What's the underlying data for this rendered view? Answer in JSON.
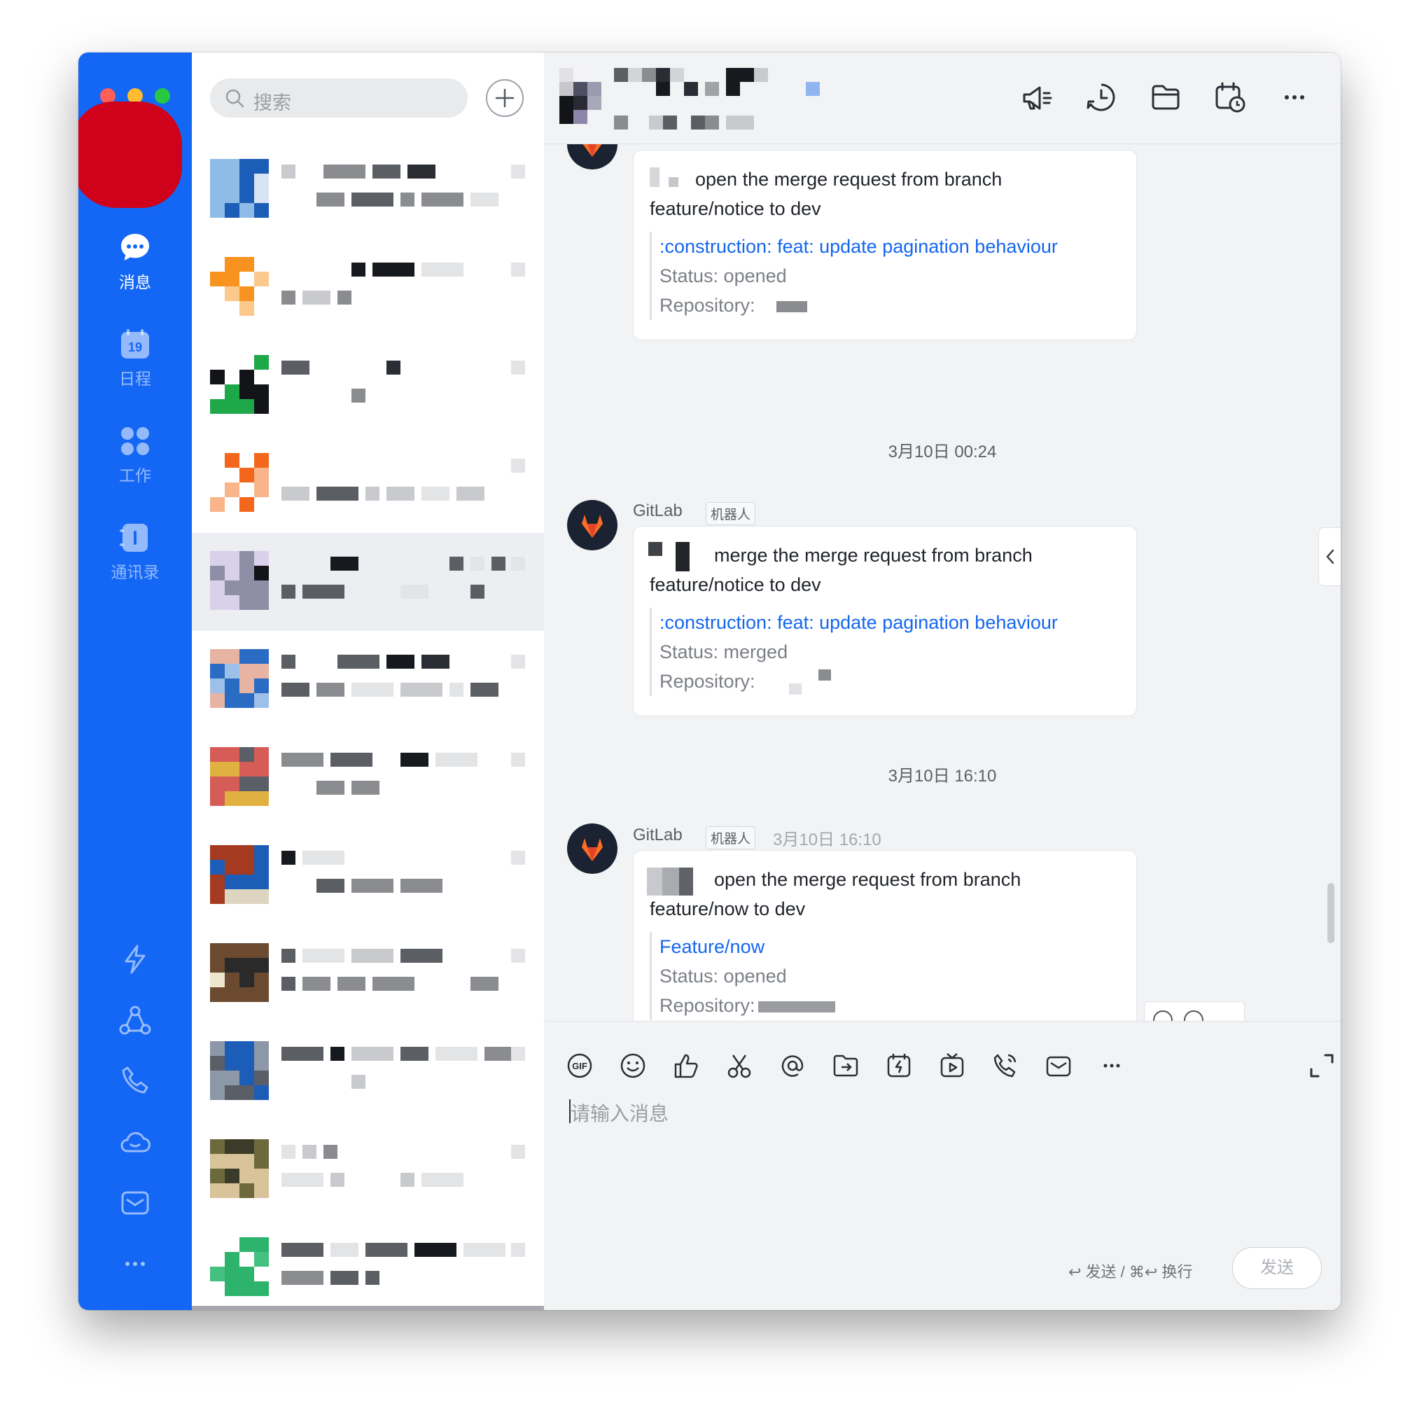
{
  "nav": {
    "items": [
      {
        "label": "消息",
        "icon": "chat-bubble-icon",
        "active": true
      },
      {
        "label": "日程",
        "icon": "calendar-icon",
        "active": false,
        "calendar_day": "19"
      },
      {
        "label": "工作",
        "icon": "apps-grid-icon",
        "active": false
      },
      {
        "label": "通讯录",
        "icon": "contacts-book-icon",
        "active": false
      }
    ],
    "bottom_icons": [
      "lightning-icon",
      "org-network-icon",
      "phone-icon",
      "cloud-icon",
      "mail-icon",
      "more-dots-icon"
    ]
  },
  "search": {
    "placeholder": "搜索"
  },
  "chat": {
    "header_icons": [
      "announcement-icon",
      "history-icon",
      "folder-icon",
      "schedule-icon",
      "more-icon"
    ],
    "timestamps": [
      "3月10日 00:24",
      "3月10日 16:10"
    ],
    "messages": [
      {
        "line1": "open the merge request from branch",
        "line2": "feature/notice to dev",
        "link": ":construction: feat: update pagination behaviour",
        "status": "Status: opened",
        "repository": "Repository:"
      },
      {
        "sender": "GitLab",
        "tag": "机器人",
        "line1": "merge the merge request from branch",
        "line2": "feature/notice to dev",
        "link": ":construction: feat: update pagination behaviour",
        "status": "Status: merged",
        "repository": "Repository:"
      },
      {
        "sender": "GitLab",
        "tag": "机器人",
        "time": "3月10日 16:10",
        "line1": "open the merge request from branch",
        "line2": "feature/now to dev",
        "link": "Feature/now",
        "status": "Status: opened",
        "repository": "Repository:"
      }
    ]
  },
  "composer": {
    "toolbar_icons": [
      "gif-icon",
      "emoji-icon",
      "thumbs-up-icon",
      "scissors-icon",
      "at-mention-icon",
      "file-send-icon",
      "quick-action-icon",
      "video-icon",
      "voice-call-icon",
      "email-icon",
      "more-icon"
    ],
    "placeholder": "请输入消息",
    "hint": "↩ 发送 / ⌘↩ 换行",
    "send_label": "发送"
  },
  "colors": {
    "rail": "#1467f5",
    "link": "#1466ee",
    "gitlab_orange": "#fc6d26"
  }
}
